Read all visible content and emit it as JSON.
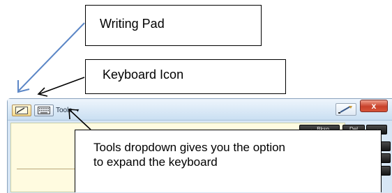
{
  "tip_window": {
    "tools_label": "Tools",
    "caret": "▾",
    "close_glyph": "x",
    "keys": [
      {
        "label": "← Bksp"
      },
      {
        "label": "Del"
      },
      {
        "label": "→"
      }
    ]
  },
  "annotations": {
    "writing_pad": "Writing Pad",
    "keyboard_icon": "Keyboard Icon",
    "tools_line1": "Tools dropdown gives you the option",
    "tools_line2": "to expand the keyboard"
  },
  "colors": {
    "arrow_blue": "#5b86c6",
    "arrow_black": "#000000",
    "writing_area": "#fffbe0",
    "close_red": "#c8412b"
  }
}
